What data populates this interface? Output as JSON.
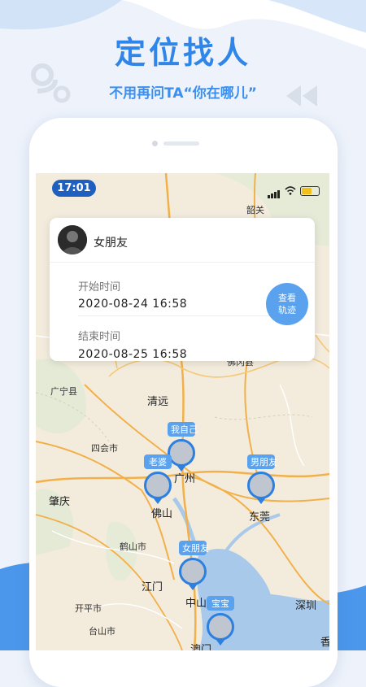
{
  "promo": {
    "headline": "定位找人",
    "subline": "不用再问TA“你在哪儿”"
  },
  "status_bar": {
    "time": "17:01"
  },
  "track_card": {
    "name": "女朋友",
    "start_label": "开始时间",
    "start_value": "2020-08-24 16:58",
    "end_label": "结束时间",
    "end_value": "2020-08-25 16:58",
    "button_line1": "查看",
    "button_line2": "轨迹"
  },
  "map": {
    "cities": {
      "shaoguan": "韶关",
      "guangning": "广宁县",
      "qingyuan": "清远",
      "sihui": "四会市",
      "guangzhou": "广州",
      "zhaoqing": "肇庆",
      "foshan": "佛山",
      "dongguan": "东莞",
      "heshan": "鹤山市",
      "jiangmen": "江门",
      "kaiping": "开平市",
      "zhongshan": "中山",
      "shenzhen": "深圳",
      "taishan": "台山市",
      "macau": "澳门",
      "hongkong": "香",
      "foganshan": "佛冈县"
    },
    "pins": [
      {
        "label": "我自己"
      },
      {
        "label": "老婆"
      },
      {
        "label": "男朋友"
      },
      {
        "label": "女朋友"
      },
      {
        "label": "宝宝"
      }
    ]
  },
  "colors": {
    "accent": "#2f86e8",
    "button": "#5aa2ee",
    "pin_border": "#2d7fe0"
  }
}
